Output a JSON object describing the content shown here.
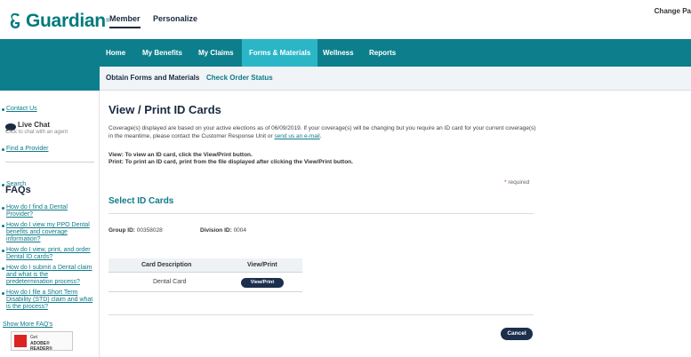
{
  "header": {
    "logo_text": "Guardian",
    "logo_tm": "®",
    "tabs": [
      "Member",
      "Personalize"
    ],
    "change_link": "Change Pa"
  },
  "nav": {
    "items": [
      "Home",
      "My Benefits",
      "My Claims",
      "Forms & Materials",
      "Wellness",
      "Reports"
    ],
    "active": "Forms & Materials"
  },
  "subnav": {
    "items": [
      "Obtain Forms and Materials",
      "Check Order Status"
    ]
  },
  "sidebar": {
    "contact_us": "Contact Us",
    "live_chat": "Live Chat",
    "live_chat_sub": "Click to chat with an agent",
    "find_provider": "Find a Provider",
    "search": "Search",
    "faqs_title": "FAQs",
    "faqs": [
      "How do I find a Dental Provider?",
      "How do I view my PPO Dental benefits and coverage information?",
      "How do I view, print, and order Dental ID cards?",
      "How do I submit a Dental claim and what is the predetermination process?",
      "How do I file a Short Term Disability (STD) claim and what is the process?"
    ],
    "show_more": "Show More FAQ's",
    "adobe_get": "Get",
    "adobe_reader": "ADOBE® READER®"
  },
  "main": {
    "title": "View / Print ID Cards",
    "intro": "Coverage(s) displayed are based on your active elections as of 06/09/2019. If your coverage(s) will be changing but you require an ID card for your current coverage(s) in the meantime, please contact the Customer Response Unit or ",
    "intro_link": "send us an e-mail",
    "intro_end": ".",
    "instr_view": "View: To view an ID card, click the View/Print button.",
    "instr_print": "Print: To print an ID card, print from the file displayed after clicking the View/Print button.",
    "required_star": "*",
    "required": " required",
    "select_title": "Select ID Cards",
    "group_label": "Group ID: ",
    "group_value": "00358028",
    "division_label": "Division ID: ",
    "division_value": "0004",
    "table_headers": [
      "Card Description",
      "View/Print"
    ],
    "rows": [
      {
        "description": "Dental Card",
        "button": "View/Print"
      }
    ],
    "cancel": "Cancel"
  },
  "colors": {
    "teal": "#0d7f8c",
    "active_tab": "#2bb6c7",
    "navy": "#1c2f4d",
    "link": "#0f7a8a"
  }
}
